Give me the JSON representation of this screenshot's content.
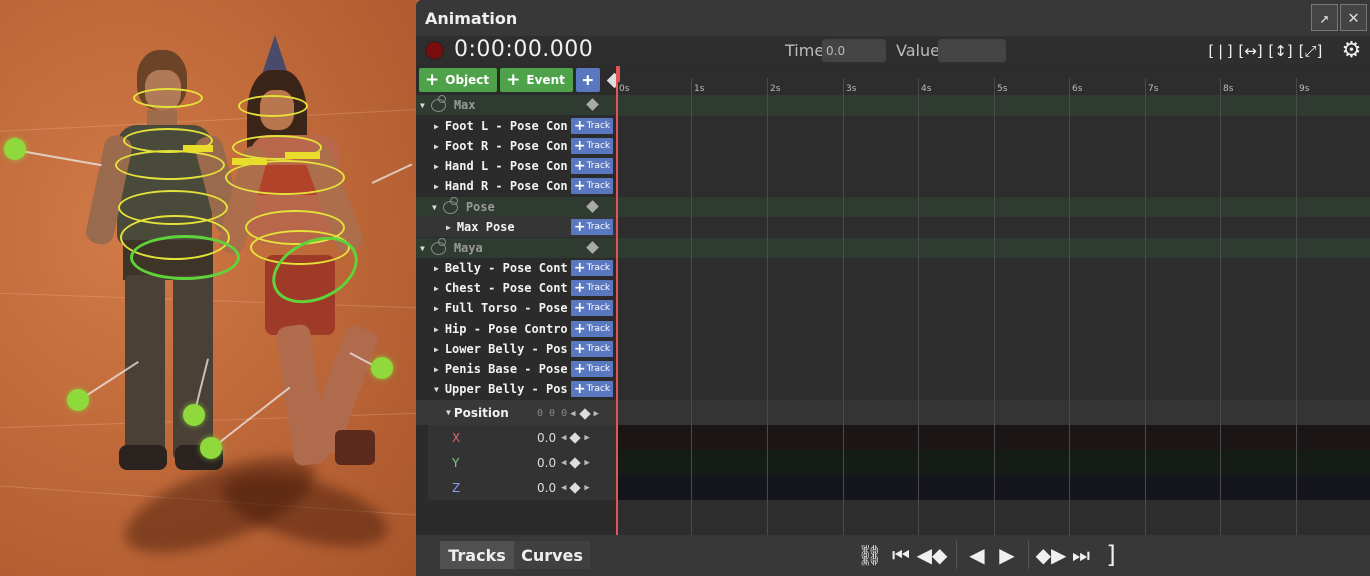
{
  "panel": {
    "title": "Animation",
    "timecode": "0:00:00.000",
    "time_label": "Time",
    "time_value": "0.0",
    "value_label": "Value",
    "value_value": ""
  },
  "buttons": {
    "object": "Object",
    "event": "Event",
    "track": "Track"
  },
  "ruler": [
    "0s",
    "1s",
    "2s",
    "3s",
    "4s",
    "5s",
    "6s",
    "7s",
    "8s",
    "9s"
  ],
  "groups": {
    "max": "Max",
    "pose": "Pose",
    "maya": "Maya"
  },
  "tracks": {
    "foot_l": "Foot L - Pose Control",
    "foot_r": "Foot R - Pose Control",
    "hand_l": "Hand L - Pose Control",
    "hand_r": "Hand R - Pose Control",
    "max_pose": "Max Pose",
    "belly": "Belly - Pose Control",
    "chest": "Chest - Pose Control",
    "full_torso": "Full Torso - Pose Control",
    "hip": "Hip - Pose Control",
    "lower_belly": "Lower Belly - Pose Control",
    "penis_base": "Penis Base - Pose Control",
    "upper_belly": "Upper Belly - Pose Control"
  },
  "property": {
    "name": "Position",
    "xyz": "0 0 0",
    "axes": [
      {
        "name": "X",
        "value": "0.0",
        "color": "#e06a6a"
      },
      {
        "name": "Y",
        "value": "0.0",
        "color": "#7ed07e"
      },
      {
        "name": "Z",
        "value": "0.0",
        "color": "#8e9cf0"
      }
    ]
  },
  "tabs": {
    "tracks": "Tracks",
    "curves": "Curves"
  },
  "colors": {
    "accent_green": "#4ea34a",
    "accent_blue": "#5a78c0",
    "playhead": "#e05555",
    "record": "#7a0d0d"
  }
}
